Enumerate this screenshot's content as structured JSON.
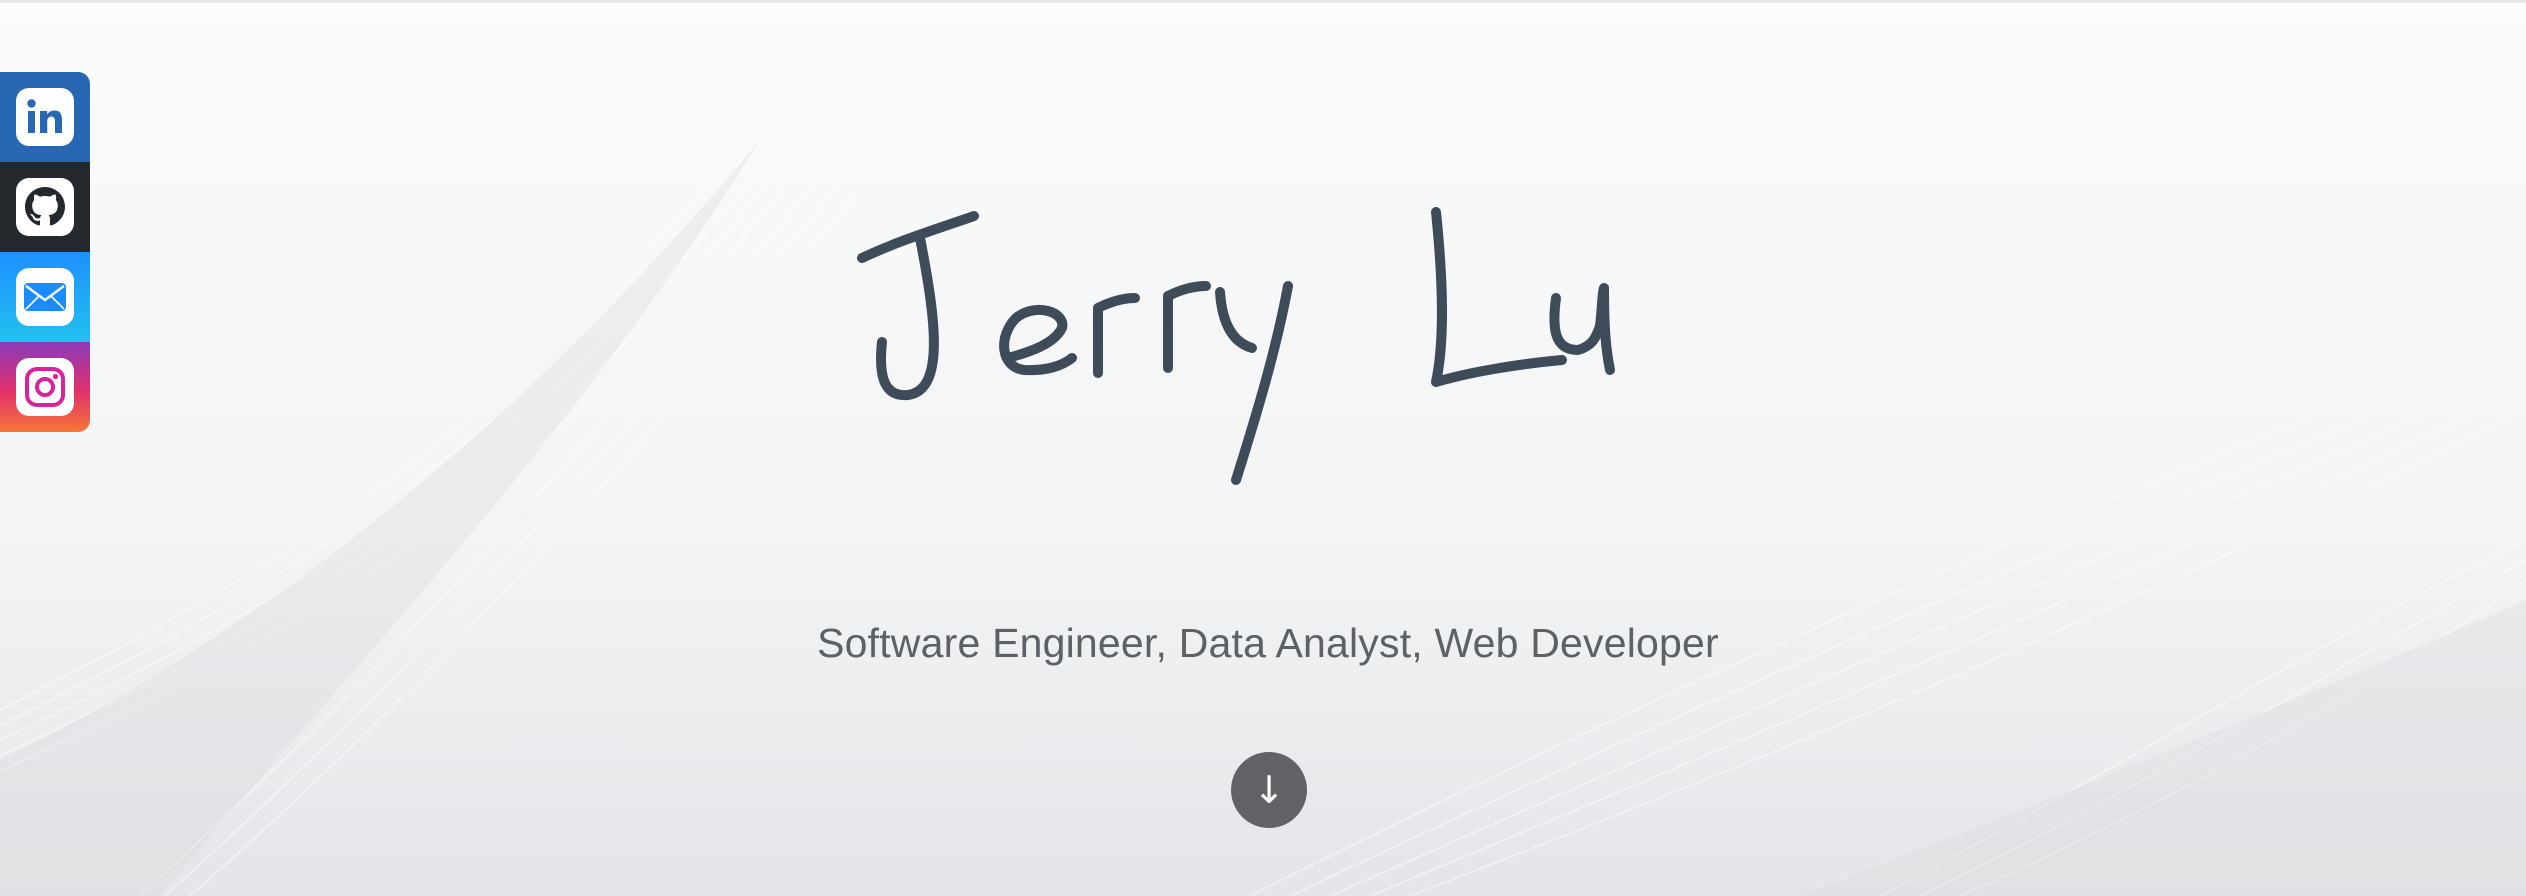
{
  "hero": {
    "name": "Jerry Lu",
    "tagline": "Software Engineer, Data Analyst, Web Developer",
    "scroll_button_glyph": "↓",
    "name_color": "#3e4c5a",
    "tagline_color": "#5c6166",
    "button_color": "#606266"
  },
  "social_links": [
    {
      "name": "LinkedIn",
      "icon": "linkedin-icon",
      "color": "#2867b2"
    },
    {
      "name": "GitHub",
      "icon": "github-icon",
      "color": "#24292e"
    },
    {
      "name": "Email",
      "icon": "mail-icon",
      "color": "#1a8cff"
    },
    {
      "name": "Instagram",
      "icon": "instagram-icon",
      "color": "#c13584"
    }
  ]
}
